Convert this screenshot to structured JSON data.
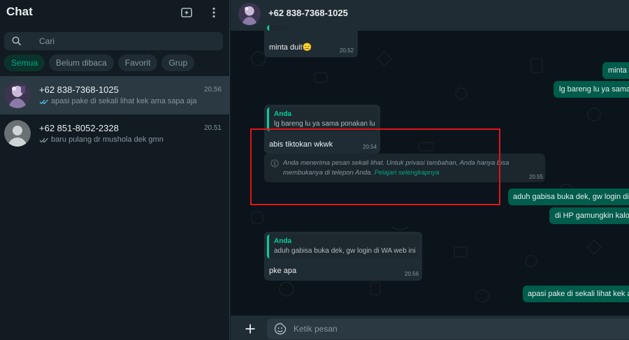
{
  "sidebar": {
    "title": "Chat",
    "icons": {
      "new_chat": "new-chat-icon",
      "menu": "more-vertical-icon",
      "search": "search-icon"
    },
    "search_placeholder": "Cari",
    "filters": [
      {
        "label": "Semua",
        "active": true
      },
      {
        "label": "Belum dibaca",
        "active": false
      },
      {
        "label": "Favorit",
        "active": false
      },
      {
        "label": "Grup",
        "active": false
      }
    ],
    "chats": [
      {
        "name": "+62 838-7368-1025",
        "time": "20.56",
        "preview": "apasi pake di sekali lihat kek ama sapa aja",
        "ticks": "read",
        "selected": true
      },
      {
        "name": "+62 851-8052-2328",
        "time": "20.51",
        "preview": "baru pulang dr mushola dek gmn",
        "ticks": "delivered",
        "selected": false
      }
    ]
  },
  "conversation": {
    "header_name": "+62 838-7368-1025",
    "messages": {
      "m1": {
        "text": "minta duit",
        "emoji": "😑",
        "time": "20.52"
      },
      "m2": {
        "text": "minta"
      },
      "m3": {
        "text": "lg bareng lu ya sama"
      },
      "m4": {
        "quote_author": "Anda",
        "quote_text": "lg bareng lu ya sama ponakan lu",
        "text": "abis tiktokan wkwk",
        "time": "20.54"
      },
      "m5": {
        "text": "aduh gabisa buka dek, gw login di"
      },
      "m6": {
        "text": "di HP gamungkin kalo"
      },
      "m7": {
        "quote_author": "Anda",
        "quote_text": "aduh gabisa buka dek, gw login di WA web ini",
        "text": "pke apa",
        "time": "20.56"
      },
      "m8": {
        "text": "apasi pake di sekali lihat kek am"
      }
    },
    "view_once_notice": {
      "text": "Anda menerima pesan sekali lihat. Untuk privasi tambahan, Anda hanya bisa membukanya di telepon Anda.",
      "link": "Pelajari selengkapnya",
      "time": "20.55"
    },
    "composer": {
      "placeholder": "Ketik pesan"
    }
  },
  "colors": {
    "panel": "#111b21",
    "header": "#202c33",
    "incoming": "#202c33",
    "outgoing": "#005c4b",
    "accent": "#00a884",
    "read_ticks": "#53bdeb",
    "highlight": "#e3131b"
  }
}
